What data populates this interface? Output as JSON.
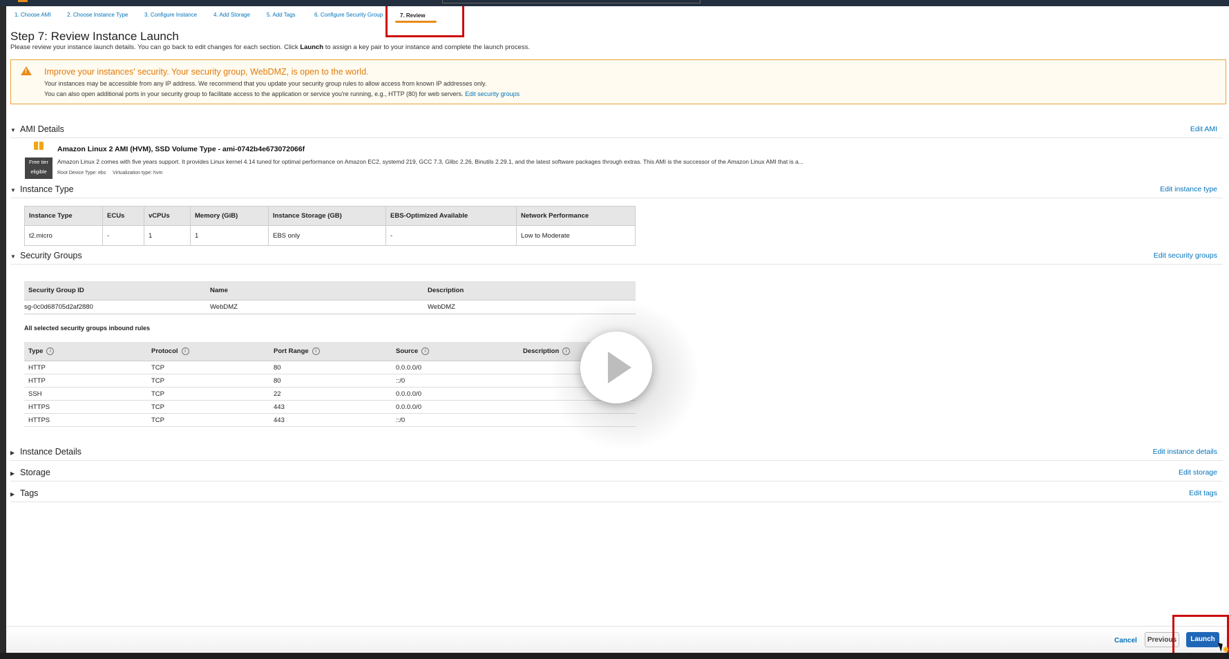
{
  "wizard": {
    "steps": [
      "1. Choose AMI",
      "2. Choose Instance Type",
      "3. Configure Instance",
      "4. Add Storage",
      "5. Add Tags",
      "6. Configure Security Group",
      "7. Review"
    ]
  },
  "header": {
    "title": "Step 7: Review Instance Launch",
    "subtitle_before": "Please review your instance launch details. You can go back to edit changes for each section. Click ",
    "subtitle_bold": "Launch",
    "subtitle_after": " to assign a key pair to your instance and complete the launch process."
  },
  "warning": {
    "title": "Improve your instances' security. Your security group, WebDMZ, is open to the world.",
    "line1": "Your instances may be accessible from any IP address. We recommend that you update your security group rules to allow access from known IP addresses only.",
    "line2": "You can also open additional ports in your security group to facilitate access to the application or service you're running, e.g., HTTP (80) for web servers.",
    "link": "Edit security groups",
    "icon": "warning-triangle-icon"
  },
  "ami": {
    "heading": "AMI Details",
    "edit": "Edit AMI",
    "title": "Amazon Linux 2 AMI (HVM), SSD Volume Type - ami-0742b4e673072066f",
    "description": "Amazon Linux 2 comes with five years support. It provides Linux kernel 4.14 tuned for optimal performance on Amazon EC2, systemd 219, GCC 7.3, Glibc 2.26, Binutils 2.29.1, and the latest software packages through extras. This AMI is the successor of the Amazon Linux AMI that is a...",
    "free_tier_1": "Free tier",
    "free_tier_2": "eligible",
    "root_device": "Root Device Type: ebs",
    "virtualization": "Virtualization type: hvm"
  },
  "instance_type": {
    "heading": "Instance Type",
    "edit": "Edit instance type",
    "columns": [
      "Instance Type",
      "ECUs",
      "vCPUs",
      "Memory (GiB)",
      "Instance Storage (GB)",
      "EBS-Optimized Available",
      "Network Performance"
    ],
    "row": [
      "t2.micro",
      "-",
      "1",
      "1",
      "EBS only",
      "-",
      "Low to Moderate"
    ]
  },
  "security_groups": {
    "heading": "Security Groups",
    "edit": "Edit security groups",
    "columns": [
      "Security Group ID",
      "Name",
      "Description"
    ],
    "row": [
      "sg-0c0d68705d2af2880",
      "WebDMZ",
      "WebDMZ"
    ],
    "rules_label": "All selected security groups inbound rules",
    "rule_columns": [
      "Type",
      "Protocol",
      "Port Range",
      "Source",
      "Description"
    ],
    "rules": [
      [
        "HTTP",
        "TCP",
        "80",
        "0.0.0.0/0",
        ""
      ],
      [
        "HTTP",
        "TCP",
        "80",
        "::/0",
        ""
      ],
      [
        "SSH",
        "TCP",
        "22",
        "0.0.0.0/0",
        ""
      ],
      [
        "HTTPS",
        "TCP",
        "443",
        "0.0.0.0/0",
        ""
      ],
      [
        "HTTPS",
        "TCP",
        "443",
        "::/0",
        ""
      ]
    ]
  },
  "instance_details": {
    "heading": "Instance Details",
    "edit": "Edit instance details"
  },
  "storage": {
    "heading": "Storage",
    "edit": "Edit storage"
  },
  "tags": {
    "heading": "Tags",
    "edit": "Edit tags"
  },
  "footer": {
    "cancel": "Cancel",
    "previous": "Previous",
    "launch": "Launch"
  },
  "colors": {
    "accent": "#0073bb",
    "warning": "#e07b0c",
    "launch_button": "#1f66b7",
    "highlight_box": "#cc0a0a"
  },
  "overlay": {
    "icon": "play-icon"
  }
}
